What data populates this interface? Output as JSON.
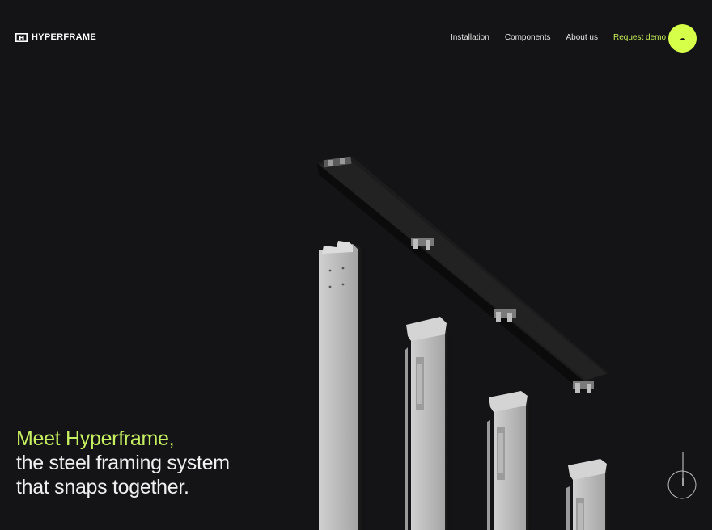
{
  "brand": {
    "name": "HYPERFRAME",
    "logo_icon": "hyperframe-logo-mark"
  },
  "nav": {
    "items": [
      {
        "label": "Installation"
      },
      {
        "label": "Components"
      },
      {
        "label": "About us"
      }
    ],
    "cta_label": "Request demo",
    "cta_icon": "hat-icon"
  },
  "hero": {
    "headline_accent": "Meet Hyperframe,",
    "headline_line1": "the steel framing system",
    "headline_line2": "that snaps together.",
    "visual": "steel-frame-studs-render",
    "scroll_icon": "scroll-down-icon"
  },
  "colors": {
    "background": "#141416",
    "accent": "#d6ff4a",
    "accent_text": "#c6ef61",
    "text": "#f0f0f0"
  }
}
